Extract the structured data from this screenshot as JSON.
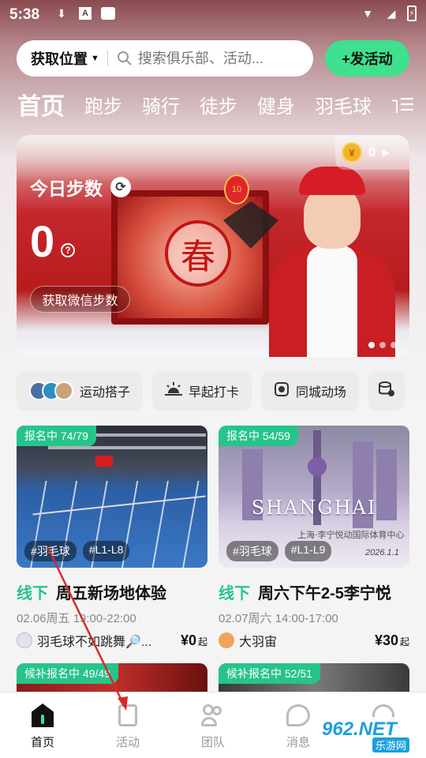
{
  "status_bar": {
    "time": "5:38",
    "icons": [
      "download-icon",
      "a-icon",
      "bag-icon"
    ],
    "right_icons": [
      "wifi-icon",
      "signal-icon",
      "battery-icon"
    ]
  },
  "search": {
    "location_label": "获取位置",
    "placeholder": "搜索俱乐部、活动..."
  },
  "publish_button": "+发活动",
  "tabs": [
    "首页",
    "跑步",
    "骑行",
    "徒步",
    "健身",
    "羽毛球",
    "T"
  ],
  "banner": {
    "steps_title": "今日步数",
    "steps_value": "0",
    "wechat_button": "获取微信步数",
    "coin_count": "0",
    "seal_char": "春",
    "lantern_num": "10"
  },
  "chips": [
    {
      "label": "运动搭子",
      "icon": "avatars-icon"
    },
    {
      "label": "早起打卡",
      "icon": "sunrise-icon"
    },
    {
      "label": "同城动场",
      "icon": "camera-icon"
    },
    {
      "label": "",
      "icon": "coins-icon"
    }
  ],
  "cards": [
    {
      "status": "报名中 74/79",
      "tags": [
        "#羽毛球",
        "#L1-L8"
      ],
      "mode": "线下",
      "title": "周五新场地体验",
      "time": "02.06周五 19:00-22:00",
      "host": "羽毛球不如跳舞🔎...",
      "price": "¥0",
      "price_suffix": "起"
    },
    {
      "status": "报名中 54/59",
      "tags": [
        "#羽毛球",
        "#L1-L9"
      ],
      "mode": "线下",
      "title": "周六下午2-5李宁悦",
      "time": "02.07周六 14:00-17:00",
      "host": "大羽宙",
      "price": "¥30",
      "price_suffix": "起",
      "poster_word": "SHANGHAI",
      "poster_sub": "上海·李宁悦动国际体育中心",
      "poster_date": "2026.1.1"
    }
  ],
  "cards_row2": [
    {
      "status": "候补报名中 49/49"
    },
    {
      "status": "候补报名中 52/51"
    }
  ],
  "bottom_nav": [
    {
      "label": "首页",
      "icon": "home-icon",
      "active": true
    },
    {
      "label": "活动",
      "icon": "activity-icon",
      "active": false
    },
    {
      "label": "团队",
      "icon": "team-icon",
      "active": false
    },
    {
      "label": "消息",
      "icon": "message-icon",
      "active": false
    },
    {
      "label": "",
      "icon": "profile-icon",
      "active": false
    }
  ],
  "watermark": {
    "text": "962.NET",
    "sub": "乐游网"
  },
  "colors": {
    "accent": "#3fe08e",
    "status_green": "#27c48a",
    "annotation_arrow": "#d62a2a"
  }
}
